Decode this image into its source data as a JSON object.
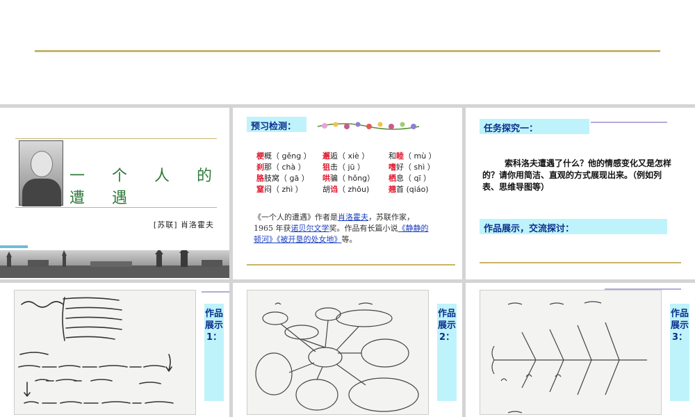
{
  "slide1": {
    "title": "一 个 人 的 遭 遇",
    "author": "[苏联] 肖洛霍夫"
  },
  "slide2": {
    "heading": "预习检测：",
    "words": [
      [
        {
          "hz": "梗",
          "rest": "概（ gěng ）"
        },
        {
          "hz": "邂",
          "rest": "逅（ xiè ）"
        },
        {
          "pre": "和",
          "hz": "睦",
          "rest": "（ mù ）"
        }
      ],
      [
        {
          "hz": "刹",
          "rest": "那（ chà ）"
        },
        {
          "hz": "狙",
          "rest": "击（ jū ）"
        },
        {
          "hz": "嗜",
          "rest": "好（ shì ）"
        }
      ],
      [
        {
          "hz": "胳",
          "rest": "肢窝（ gā ）"
        },
        {
          "hz": "哄",
          "rest": "骗（ hǒng）"
        },
        {
          "hz": "栖",
          "rest": "息（ qī ）"
        }
      ],
      [
        {
          "hz": "窒",
          "rest": "闷（ zhì ）"
        },
        {
          "pre": "胡",
          "hz": "诌",
          "rest": "（ zhōu)"
        },
        {
          "hz": "翘",
          "rest": "首 (qiáo)"
        }
      ]
    ],
    "para_1": "《一个人的遭遇》作者是",
    "author_blank": "肖洛霍夫",
    "para_2": "，苏联作家，1965 年获",
    "prize": "诺贝尔文学",
    "para_3": "奖。作品有长篇小说",
    "novels": "《静静的顿河》《被开垦的处女地》",
    "para_4": "等。"
  },
  "slide3": {
    "heading": "任务探究一：",
    "question": "索科洛夫遭遇了什么？他的情感变化又是怎样的？请你用简洁、直观的方式展现出来。（例如列表、思维导图等）",
    "show": "作品展示，交流探讨："
  },
  "slide4": {
    "caption": "作品展示1："
  },
  "slide5": {
    "caption": "作品展示2："
  },
  "slide6": {
    "caption": "作品展示3："
  }
}
